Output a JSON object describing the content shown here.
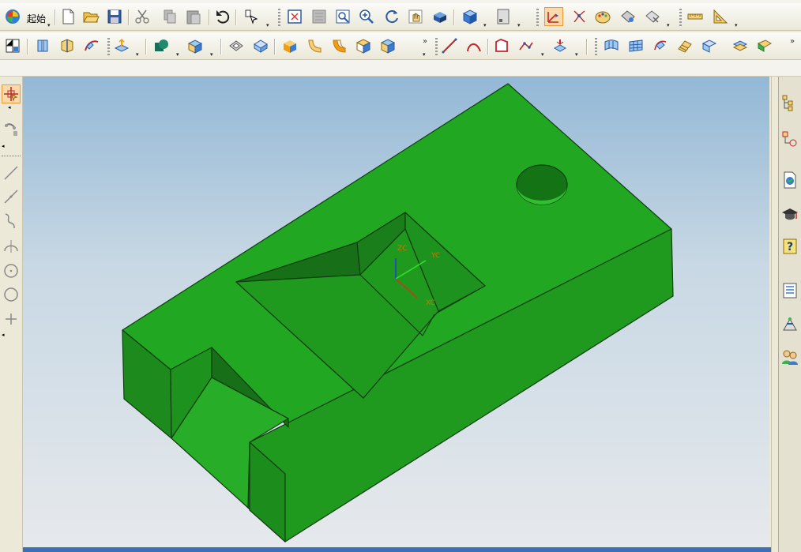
{
  "toolbar": {
    "start_label": "起始",
    "row1_icons": [
      "nx-logo-icon",
      "new-file-icon",
      "open-folder-icon",
      "save-icon",
      "cut-icon",
      "copy-icon",
      "paste-icon",
      "undo-icon",
      "selection-filter-icon",
      "fit-view-icon",
      "zoom-window-icon",
      "zoom-box-icon",
      "zoom-in-icon",
      "rotate-icon",
      "pan-icon",
      "shaded-view-icon",
      "view-cube-icon",
      "layout-icon",
      "wcs-orient-icon",
      "wcs-origin-icon",
      "palette-icon",
      "display-edit-icon",
      "hide-show-icon",
      "measure-distance-icon",
      "measure-angle-icon"
    ],
    "row2_icons": [
      "sketch-layout-icon",
      "extrude-icon",
      "revolve-icon",
      "sweep-icon",
      "datum-plane-icon",
      "boolean-unite-icon",
      "blend-icon",
      "block-icon",
      "sphere-icon",
      "edge-blend-icon",
      "chamfer-icon",
      "shell-icon",
      "draft-icon",
      "line-icon",
      "arc-icon",
      "fillet-curve-icon",
      "point-icon",
      "projection-icon",
      "surface-through-curves-icon",
      "mesh-surface-icon",
      "swept-surface-icon",
      "ruled-surface-icon",
      "bounded-plane-icon",
      "offset-surface-icon",
      "trim-sheet-icon"
    ]
  },
  "left_bar": {
    "icons": [
      "point-selector-icon",
      "snap-settings-icon",
      "line-tool-icon",
      "line-segment-icon",
      "spline-icon",
      "arc-tool-icon",
      "circle-center-icon",
      "circle-icon",
      "point-plus-icon"
    ]
  },
  "right_bar": {
    "icons": [
      "assembly-navigator-icon",
      "part-navigator-icon",
      "web-browser-icon",
      "training-icon",
      "help-icon",
      "history-icon",
      "system-materials-icon",
      "roles-icon"
    ]
  },
  "viewport": {
    "model_color": "#22a722",
    "axis": {
      "z_label": "ZC",
      "y_label": "YC",
      "x_label": "XC"
    }
  }
}
